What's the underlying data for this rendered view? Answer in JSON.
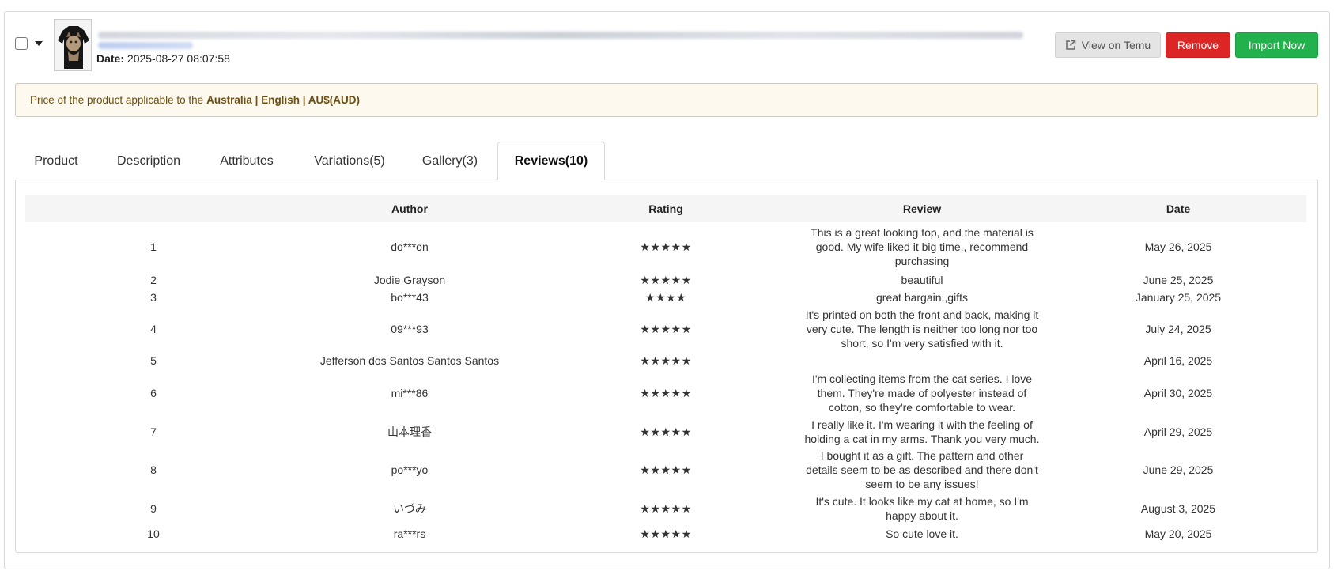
{
  "header": {
    "date_label": "Date:",
    "date_value": "2025-08-27 08:07:58"
  },
  "buttons": {
    "view": "View on Temu",
    "remove": "Remove",
    "import": "Import Now"
  },
  "notice": {
    "prefix": "Price of the product applicable to the",
    "region": "Australia | English | AU$(AUD)"
  },
  "tabs": [
    {
      "label": "Product"
    },
    {
      "label": "Description"
    },
    {
      "label": "Attributes"
    },
    {
      "label": "Variations(5)"
    },
    {
      "label": "Gallery(3)"
    },
    {
      "label": "Reviews(10)"
    }
  ],
  "reviews": {
    "columns": [
      "",
      "Author",
      "Rating",
      "Review",
      "Date"
    ],
    "rows": [
      {
        "index": "1",
        "author": "do***on",
        "rating": "★★★★★",
        "review": "This is a great looking top, and the material is good. My wife liked it big time., recommend purchasing",
        "date": "May 26, 2025"
      },
      {
        "index": "2",
        "author": "Jodie Grayson",
        "rating": "★★★★★",
        "review": "beautiful",
        "date": "June 25, 2025"
      },
      {
        "index": "3",
        "author": "bo***43",
        "rating": "★★★★",
        "review": "great bargain.,gifts",
        "date": "January 25, 2025"
      },
      {
        "index": "4",
        "author": "09***93",
        "rating": "★★★★★",
        "review": "It's printed on both the front and back, making it very cute. The length is neither too long nor too short, so I'm very satisfied with it.",
        "date": "July 24, 2025"
      },
      {
        "index": "5",
        "author": "Jefferson dos Santos Santos Santos",
        "rating": "★★★★★",
        "review": "",
        "date": "April 16, 2025"
      },
      {
        "index": "6",
        "author": "mi***86",
        "rating": "★★★★★",
        "review": "I'm collecting items from the cat series. I love them. They're made of polyester instead of cotton, so they're comfortable to wear.",
        "date": "April 30, 2025"
      },
      {
        "index": "7",
        "author": "山本理香",
        "rating": "★★★★★",
        "review": "I really like it. I'm wearing it with the feeling of holding a cat in my arms. Thank you very much.",
        "date": "April 29, 2025"
      },
      {
        "index": "8",
        "author": "po***yo",
        "rating": "★★★★★",
        "review": "I bought it as a gift. The pattern and other details seem to be as described and there don't seem to be any issues!",
        "date": "June 29, 2025"
      },
      {
        "index": "9",
        "author": "いづみ",
        "rating": "★★★★★",
        "review": "It's cute. It looks like my cat at home, so I'm happy about it.",
        "date": "August 3, 2025"
      },
      {
        "index": "10",
        "author": "ra***rs",
        "rating": "★★★★★",
        "review": "So cute love it.",
        "date": "May 20, 2025"
      }
    ]
  }
}
